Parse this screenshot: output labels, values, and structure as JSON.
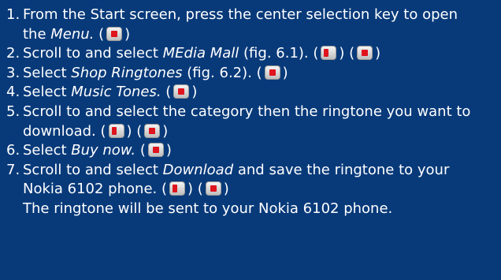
{
  "steps": [
    {
      "num": "1.",
      "line1": "From the Start screen, press the center selection key to open",
      "line2a": "the ",
      "line2em": "Menu.",
      "line2b": " ("
    },
    {
      "num": "2.",
      "a": "Scroll to and select ",
      "em": "MEdia Mall",
      "b": " (fig. 6.1). ("
    },
    {
      "num": "3.",
      "a": "Select ",
      "em": "Shop Ringtones",
      "b": " (fig. 6.2). ("
    },
    {
      "num": "4.",
      "a": "Select ",
      "em": "Music Tones.",
      "b": "  ("
    },
    {
      "num": "5.",
      "line1": "Scroll to and select the category then the ringtone you want to",
      "line2": "download.    ("
    },
    {
      "num": "6.",
      "a": "Select ",
      "em": "Buy now.",
      "b": "  ("
    },
    {
      "num": "7.",
      "line1a": "Scroll to and select ",
      "line1em": "Download",
      "line1b": " and save the ringtone to your",
      "line2": "Nokia 6102 phone.  ("
    }
  ],
  "paren_close": ")",
  "paren_sep": ") (",
  "note": "The ringtone will be sent to your Nokia 6102 phone.",
  "icons": {
    "center": "select-key-icon",
    "scroll": "scroll-key-icon"
  },
  "colors": {
    "background": "#083a7a",
    "text": "#ffffff",
    "key_red": "#e0141e"
  }
}
